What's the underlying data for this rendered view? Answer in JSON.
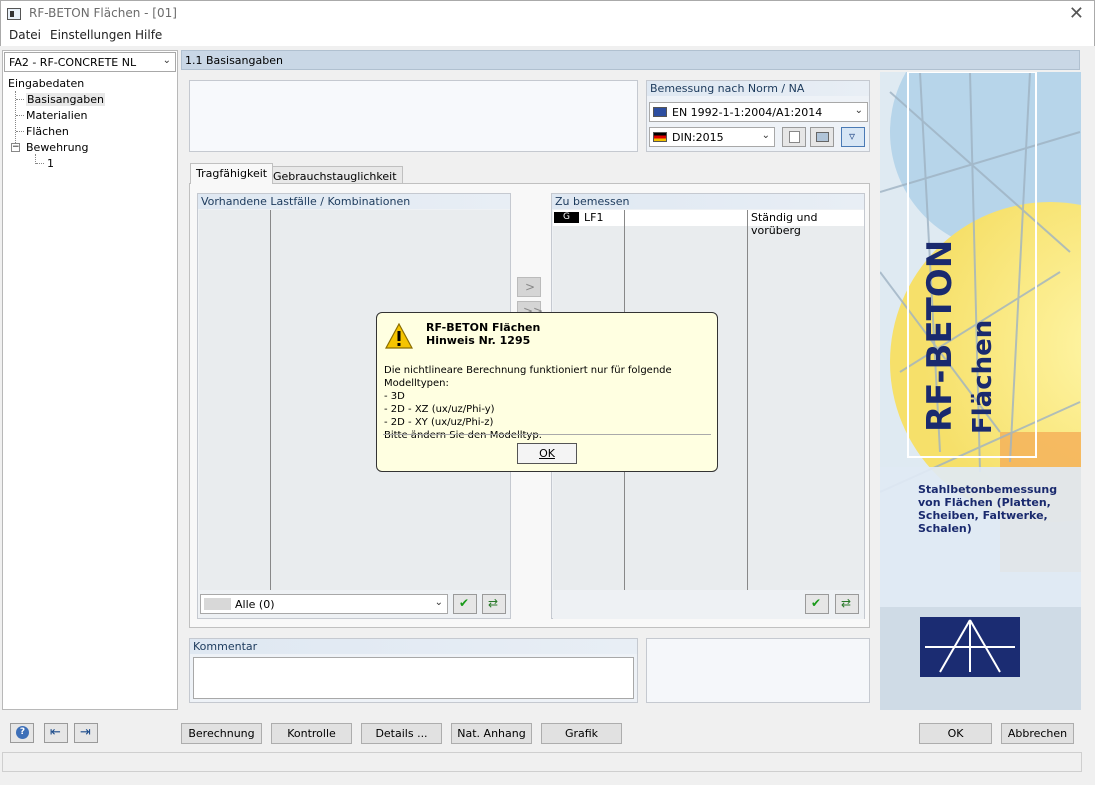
{
  "window": {
    "title": "RF-BETON Flächen - [01]",
    "close_glyph": "✕"
  },
  "menu": [
    "Datei",
    "Einstellungen",
    "Hilfe"
  ],
  "left_panel": {
    "case_select": "FA2 - RF-CONCRETE NL",
    "tree": {
      "root": "Eingabedaten",
      "items": [
        "Basisangaben",
        "Materialien",
        "Flächen",
        "Bewehrung"
      ],
      "subitem": "1"
    }
  },
  "section_header": "1.1 Basisangaben",
  "norm": {
    "label": "Bemessung nach Norm / NA",
    "standard": "EN 1992-1-1:2004/A1:2014",
    "national_annex": "DIN:2015"
  },
  "tabs": [
    "Tragfähigkeit",
    "Gebrauchstauglichkeit"
  ],
  "available": {
    "label": "Vorhandene Lastfälle / Kombinationen",
    "filter": "Alle (0)"
  },
  "to_design": {
    "label": "Zu bemessen",
    "rows": [
      {
        "badge": "G",
        "name": "LF1",
        "type": "Ständig und vorüberg"
      }
    ]
  },
  "transfer_buttons": [
    ">",
    ">>"
  ],
  "comment": {
    "label": "Kommentar",
    "value": ""
  },
  "dialog": {
    "title": "RF-BETON Flächen",
    "subtitle": "Hinweis Nr. 1295",
    "lines": [
      "Die nichtlineare Berechnung funktioniert nur für folgende Modelltypen:",
      "- 3D",
      "- 2D - XZ (ux/uz/Phi-y)",
      "- 2D - XY (ux/uz/Phi-z)",
      "Bitte ändern Sie den Modelltyp."
    ],
    "ok_label": "OK"
  },
  "sidebar": {
    "brand_big": "RF-BETON",
    "brand_sub": "Flächen",
    "description": "Stahlbetonbemessung von Flächen (Platten, Scheiben, Faltwerke, Schalen)"
  },
  "bottom_buttons": {
    "berechnung": "Berechnung",
    "kontrolle": "Kontrolle",
    "details": "Details ...",
    "nat_anhang": "Nat. Anhang",
    "grafik": "Grafik",
    "ok": "OK",
    "abbrechen": "Abbrechen"
  },
  "colors": {
    "header_strip": "#c9d7e6",
    "dialog_bg": "#ffffe1",
    "brand_navy": "#1a2a6e",
    "warning_yellow": "#f5c400"
  }
}
